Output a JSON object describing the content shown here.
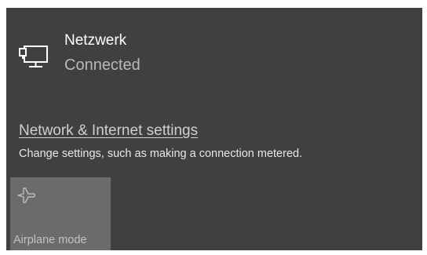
{
  "network": {
    "name": "Netzwerk",
    "status": "Connected",
    "icon": "wired-network-icon"
  },
  "settings": {
    "link_label": "Network & Internet settings",
    "description": "Change settings, such as making a connection metered."
  },
  "quick_actions": [
    {
      "label": "Airplane mode",
      "icon": "airplane-icon",
      "state": "off"
    }
  ],
  "colors": {
    "flyout_background": "#404040",
    "tile_background": "#6b6b6b",
    "secondary_text": "#b9b9b9"
  }
}
